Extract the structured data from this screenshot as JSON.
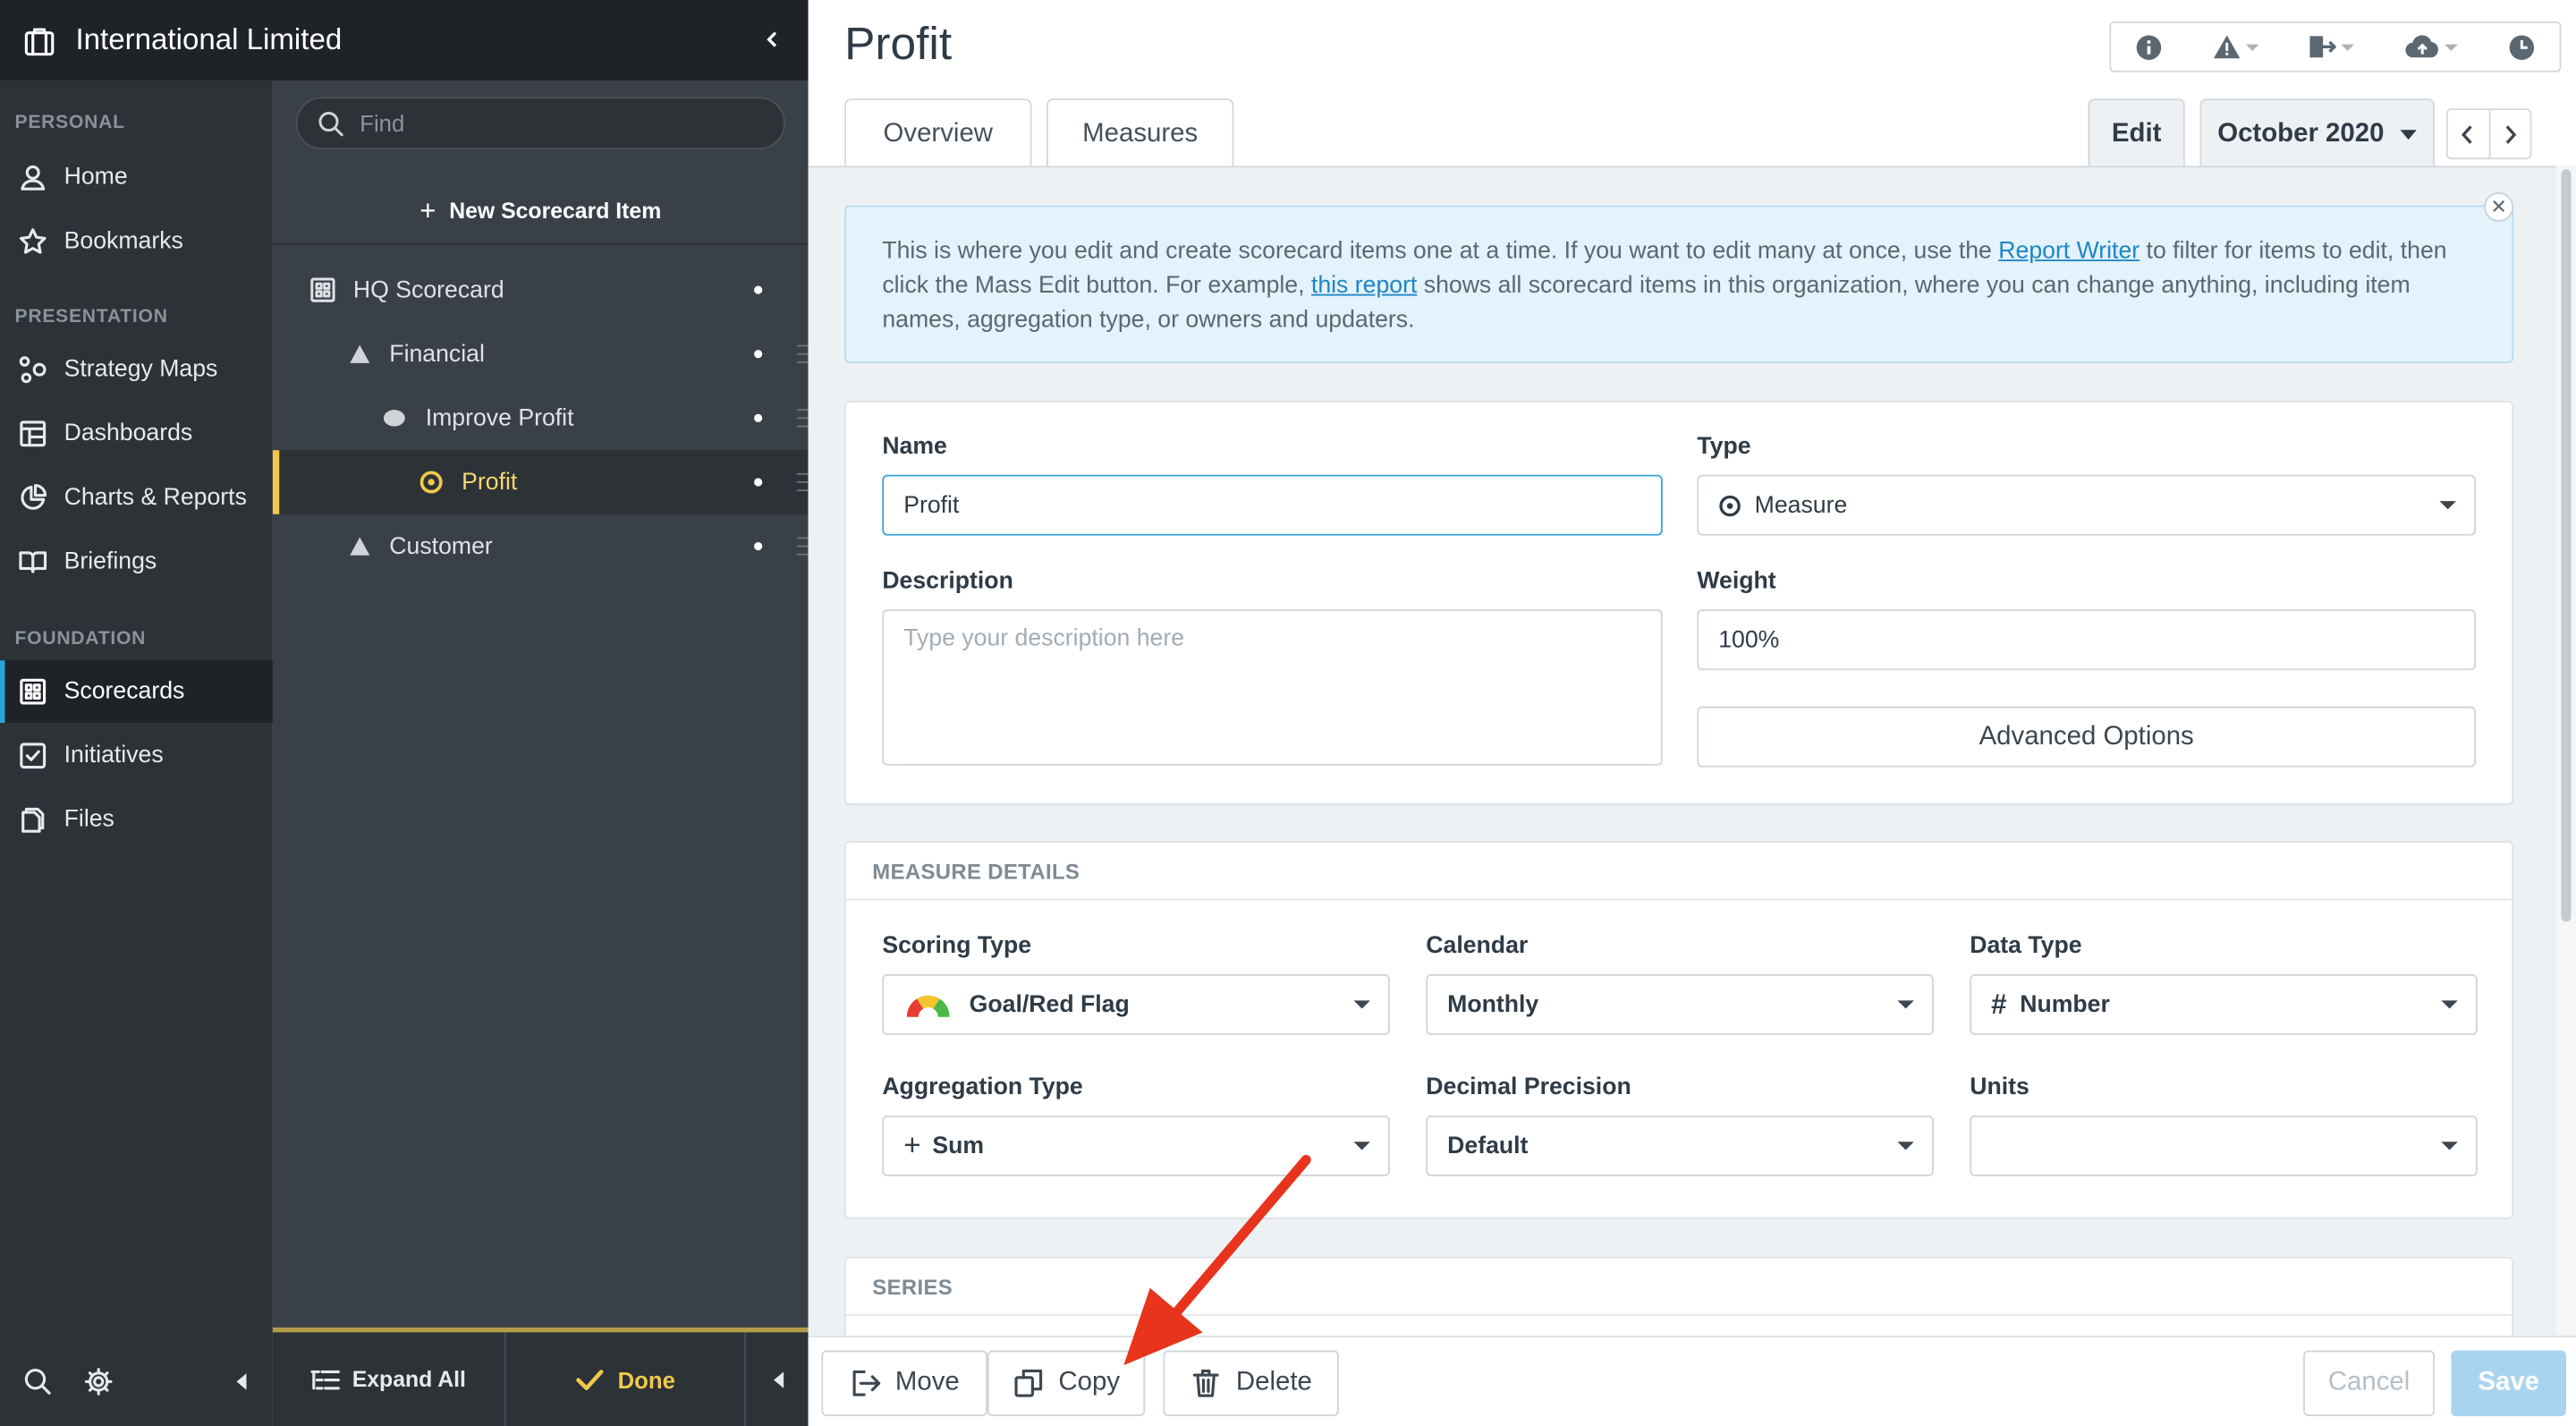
{
  "header": {
    "org_name": "International Limited"
  },
  "nav": {
    "sections": {
      "personal": "PERSONAL",
      "presentation": "PRESENTATION",
      "foundation": "FOUNDATION"
    },
    "items": [
      {
        "label": "Home",
        "icon": "user-icon"
      },
      {
        "label": "Bookmarks",
        "icon": "star-icon"
      },
      {
        "label": "Strategy Maps",
        "icon": "strategy-map-icon"
      },
      {
        "label": "Dashboards",
        "icon": "dashboard-icon"
      },
      {
        "label": "Charts & Reports",
        "icon": "pie-chart-icon"
      },
      {
        "label": "Briefings",
        "icon": "book-icon"
      },
      {
        "label": "Scorecards",
        "icon": "grid-icon",
        "active": true
      },
      {
        "label": "Initiatives",
        "icon": "checkbox-icon"
      },
      {
        "label": "Files",
        "icon": "files-icon"
      }
    ]
  },
  "tree": {
    "find_placeholder": "Find",
    "new_item_label": "New Scorecard Item",
    "rows": [
      {
        "label": "HQ Scorecard"
      },
      {
        "label": "Financial"
      },
      {
        "label": "Improve Profit"
      },
      {
        "label": "Profit",
        "selected": true
      },
      {
        "label": "Customer"
      }
    ],
    "expand_all_label": "Expand All",
    "done_label": "Done"
  },
  "main": {
    "title": "Profit",
    "tabs": {
      "overview": "Overview",
      "measures": "Measures",
      "edit": "Edit"
    },
    "period": "October 2020",
    "notice": {
      "part1": "This is where you edit and create scorecard items one at a time. If you want to edit many at once, use the ",
      "link1": "Report Writer",
      "part2": " to filter for items to edit, then click the Mass Edit button. For example, ",
      "link2": "this report",
      "part3": " shows all scorecard items in this organization, where you can change anything, including item names, aggregation type, or owners and updaters."
    },
    "form": {
      "name_label": "Name",
      "name_value": "Profit",
      "type_label": "Type",
      "type_value": "Measure",
      "description_label": "Description",
      "description_placeholder": "Type your description here",
      "weight_label": "Weight",
      "weight_value": "100%",
      "advanced_label": "Advanced Options"
    },
    "measure_details": {
      "heading": "MEASURE DETAILS",
      "scoring_type_label": "Scoring Type",
      "scoring_type_value": "Goal/Red Flag",
      "calendar_label": "Calendar",
      "calendar_value": "Monthly",
      "data_type_label": "Data Type",
      "data_type_value": "Number",
      "aggregation_label": "Aggregation Type",
      "aggregation_value": "Sum",
      "precision_label": "Decimal Precision",
      "precision_value": "Default",
      "units_label": "Units",
      "units_value": ""
    },
    "series_heading": "SERIES"
  },
  "actions": {
    "move": "Move",
    "copy": "Copy",
    "delete": "Delete",
    "cancel": "Cancel",
    "save": "Save"
  },
  "colors": {
    "accent": "#2aa3dd",
    "selected": "#f0c94a",
    "arrow": "#e8341c",
    "save": "#a9d4f0"
  }
}
